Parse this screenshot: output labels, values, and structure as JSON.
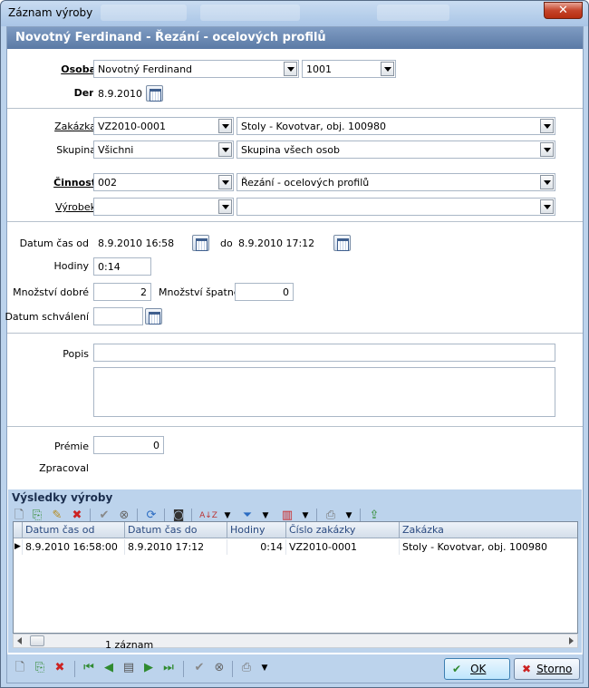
{
  "window": {
    "title": "Záznam výroby",
    "close_glyph": "✕"
  },
  "header": {
    "title": "Novotný Ferdinand  -  Řezání - ocelových profilů"
  },
  "form": {
    "osoba": {
      "label": "Osoba",
      "name": "Novotný Ferdinand",
      "code": "1001"
    },
    "den": {
      "label": "Den",
      "value": "8.9.2010"
    },
    "zakazka": {
      "label": "Zakázka",
      "code": "VZ2010-0001",
      "name": "Stoly - Kovotvar, obj. 100980"
    },
    "skupina": {
      "label": "Skupina",
      "code": "Všichni",
      "name": "Skupina všech osob"
    },
    "cinnost": {
      "label": "Činnost",
      "code": "002",
      "name": "Řezání - ocelových profilů"
    },
    "vyrobek": {
      "label": "Výrobek",
      "code": "",
      "name": ""
    },
    "datum_od": {
      "label": "Datum čas od",
      "value": "8.9.2010 16:58"
    },
    "datum_do": {
      "label": "do",
      "value": "8.9.2010 17:12"
    },
    "hodiny": {
      "label": "Hodiny",
      "value": "0:14"
    },
    "mnozstvi_dobre": {
      "label": "Množství dobré",
      "value": "2"
    },
    "mnozstvi_spatne": {
      "label": "Množství špatné",
      "value": "0"
    },
    "datum_schvaleni": {
      "label": "Datum schválení",
      "value": ""
    },
    "popis": {
      "label": "Popis",
      "line1": "",
      "text": ""
    },
    "premie": {
      "label": "Prémie",
      "value": "0"
    },
    "zpracoval": {
      "label": "Zpracoval"
    }
  },
  "results": {
    "title": "Výsledky výroby",
    "columns": [
      "Datum čas od",
      "Datum čas do",
      "Hodiny",
      "Číslo zakázky",
      "Zakázka"
    ],
    "rows": [
      {
        "od": "8.9.2010 16:58:00",
        "do": "8.9.2010 17:12",
        "hodiny": "0:14",
        "cislo": "VZ2010-0001",
        "zakazka": "Stoly - Kovotvar, obj. 100980"
      }
    ],
    "status": "1 záznam"
  },
  "buttons": {
    "ok": "OK",
    "storno": "Storno"
  },
  "icons": [
    "new-icon",
    "copy-icon",
    "edit-icon",
    "delete-icon",
    "confirm-icon",
    "cancel-icon",
    "refresh-icon",
    "binoculars-icon",
    "sort-icon",
    "filter-icon",
    "columns-icon",
    "print-icon",
    "export-icon"
  ],
  "colors": {
    "header_bg": "#5b7aa5",
    "window_bg": "#bcd3ec"
  }
}
